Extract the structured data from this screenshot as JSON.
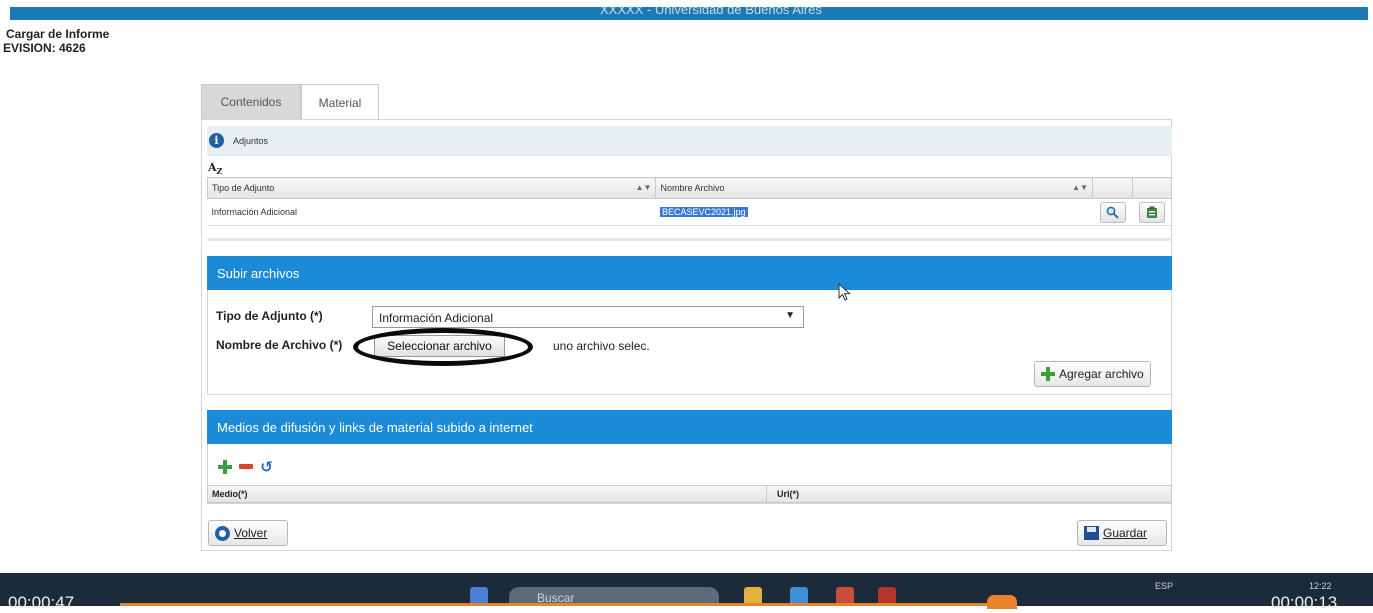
{
  "window": {
    "title": "XXXXX - Universidad de Buenos Aires",
    "heading": "Cargar de Informe",
    "subheading": "EVISION: 4626"
  },
  "tabs": [
    {
      "label": "Contenidos",
      "active": false
    },
    {
      "label": "Material",
      "active": true
    }
  ],
  "adjuntos": {
    "label": "Adjuntos",
    "sort_icon": "AZ",
    "columns": [
      "Tipo de Adjunto",
      "Nombre Archivo"
    ],
    "rows": [
      {
        "tipo": "Información Adicional",
        "nombre": "BECASEVC2021.jpg"
      }
    ],
    "row_actions": [
      "magnifier-icon",
      "clipboard-icon"
    ]
  },
  "subir": {
    "header": "Subir archivos",
    "tipo_label": "Tipo de Adjunto (*)",
    "tipo_value": "Información Adicional",
    "nombre_label": "Nombre de Archivo (*)",
    "file_button": "Seleccionar archivo",
    "file_status": "uno archivo selec.",
    "add_button": "Agregar archivo"
  },
  "medios": {
    "header": "Medios de difusión y links de material subido a internet",
    "toolbar_icons": [
      "plus-icon",
      "minus-icon",
      "undo-icon"
    ],
    "columns": [
      "Medio(*)",
      "Url(*)"
    ]
  },
  "footer": {
    "back_button": "Volver",
    "save_button": "Guardar"
  },
  "taskbar": {
    "time_left": "00:00:47",
    "time_right": "00:00:13",
    "search_placeholder": "Buscar",
    "lang": "ESP",
    "clock": "12:22"
  },
  "colors": {
    "accent": "#1b8bd8",
    "topbar": "#1a7ab5",
    "progress": "#e8832d"
  }
}
